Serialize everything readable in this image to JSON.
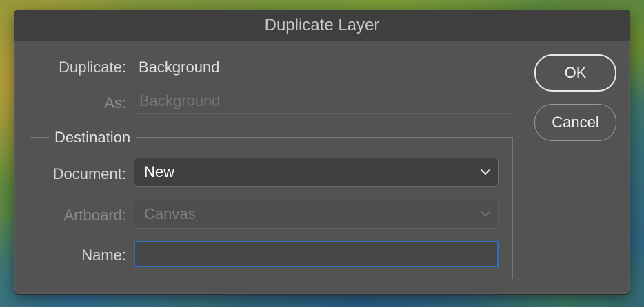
{
  "dialog": {
    "title": "Duplicate Layer",
    "duplicate_label": "Duplicate:",
    "duplicate_value": "Background",
    "as_label": "As:",
    "as_placeholder": "Background",
    "destination": {
      "title": "Destination",
      "document_label": "Document:",
      "document_value": "New",
      "artboard_label": "Artboard:",
      "artboard_value": "Canvas",
      "name_label": "Name:",
      "name_value": ""
    },
    "buttons": {
      "ok_label": "OK",
      "cancel_label": "Cancel"
    }
  },
  "icons": {
    "document_select": "chevron-down-icon",
    "artboard_select": "chevron-down-icon"
  },
  "colors": {
    "dialog_background": "#535353",
    "titlebar_background": "#3f3f3f",
    "focus_ring": "#2f6fc2"
  }
}
